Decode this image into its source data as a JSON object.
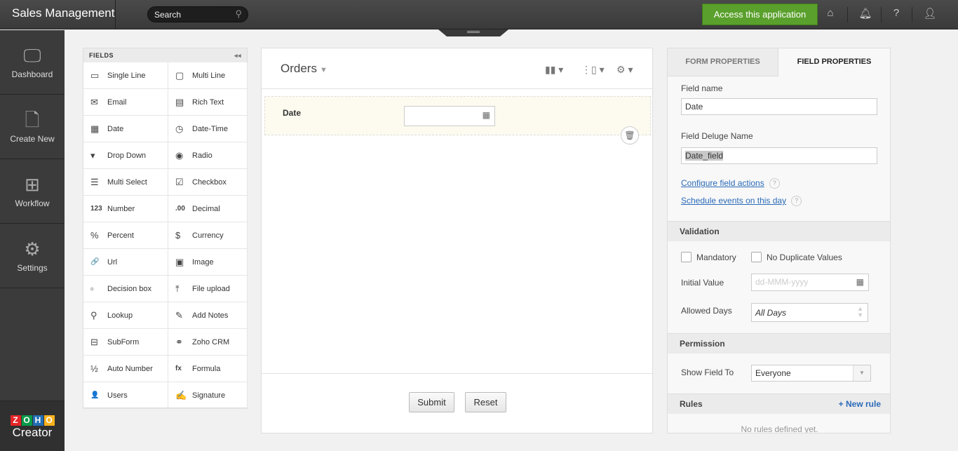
{
  "header": {
    "app_title": "Sales Management",
    "search_placeholder": "Search",
    "access_label": "Access this application"
  },
  "sidebar": {
    "items": [
      {
        "label": "Dashboard",
        "icon": "monitor-icon",
        "glyph": "🖵"
      },
      {
        "label": "Create New",
        "icon": "new-file-icon",
        "glyph": "🗋"
      },
      {
        "label": "Workflow",
        "icon": "workflow-icon",
        "glyph": "⊞"
      },
      {
        "label": "Settings",
        "icon": "gear-icon",
        "glyph": "⚙"
      }
    ],
    "logo_letters": [
      "Z",
      "O",
      "H",
      "O"
    ],
    "logo_text": "Creator",
    "logo_colors": [
      "#e42527",
      "#089949",
      "#226db4",
      "#f9b21d"
    ]
  },
  "fields": {
    "title": "FIELDS",
    "items": [
      {
        "label": "Single Line",
        "glyph": "▭"
      },
      {
        "label": "Multi Line",
        "glyph": "▢"
      },
      {
        "label": "Email",
        "glyph": "✉"
      },
      {
        "label": "Rich Text",
        "glyph": "▤"
      },
      {
        "label": "Date",
        "glyph": "▦"
      },
      {
        "label": "Date-Time",
        "glyph": "◷"
      },
      {
        "label": "Drop Down",
        "glyph": "▾"
      },
      {
        "label": "Radio",
        "glyph": "◉"
      },
      {
        "label": "Multi Select",
        "glyph": "☰"
      },
      {
        "label": "Checkbox",
        "glyph": "☑"
      },
      {
        "label": "Number",
        "glyph": "123"
      },
      {
        "label": "Decimal",
        "glyph": ".00"
      },
      {
        "label": "Percent",
        "glyph": "%"
      },
      {
        "label": "Currency",
        "glyph": "$"
      },
      {
        "label": "Url",
        "glyph": "🔗"
      },
      {
        "label": "Image",
        "glyph": "▣"
      },
      {
        "label": "Decision box",
        "glyph": "▫"
      },
      {
        "label": "File upload",
        "glyph": "⤒"
      },
      {
        "label": "Lookup",
        "glyph": "⚲"
      },
      {
        "label": "Add Notes",
        "glyph": "✎"
      },
      {
        "label": "SubForm",
        "glyph": "⊟"
      },
      {
        "label": "Zoho CRM",
        "glyph": "⚭"
      },
      {
        "label": "Auto Number",
        "glyph": "½"
      },
      {
        "label": "Formula",
        "glyph": "fx"
      },
      {
        "label": "Users",
        "glyph": "👤"
      },
      {
        "label": "Signature",
        "glyph": "✍"
      }
    ]
  },
  "form": {
    "title": "Orders",
    "field_label": "Date",
    "submit": "Submit",
    "reset": "Reset"
  },
  "props": {
    "tab_form": "FORM PROPERTIES",
    "tab_field": "FIELD PROPERTIES",
    "field_name_label": "Field name",
    "field_name": "Date",
    "deluge_label": "Field Deluge Name",
    "deluge_name": "Date_field",
    "link_actions": "Configure field actions",
    "link_schedule": "Schedule events on this day",
    "help": "?",
    "validation": "Validation",
    "mandatory": "Mandatory",
    "no_dup": "No Duplicate Values",
    "initial_label": "Initial Value",
    "initial_placeholder": "dd-MMM-yyyy",
    "allowed_label": "Allowed Days",
    "allowed_value": "All Days",
    "permission": "Permission",
    "show_label": "Show Field To",
    "show_value": "Everyone",
    "rules": "Rules",
    "new_rule": "+ New rule",
    "no_rules": "No rules defined yet."
  }
}
